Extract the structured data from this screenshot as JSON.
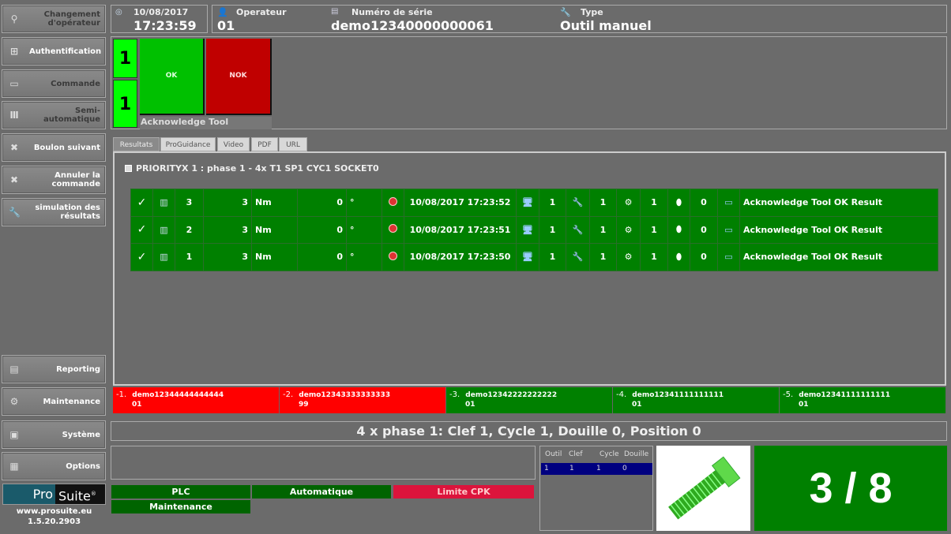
{
  "sidebar": {
    "top": [
      {
        "label": "Changement d'opérateur",
        "icon": "user-change-icon",
        "dim": true
      },
      {
        "label": "Authentification",
        "icon": "login-icon",
        "dim": false
      },
      {
        "label": "Commande",
        "icon": "order-icon",
        "dim": true
      },
      {
        "label": "Semi-automatique",
        "icon": "semi-auto-icon",
        "dim": true
      },
      {
        "label": "Boulon suivant",
        "icon": "next-bolt-icon",
        "dim": false
      },
      {
        "label": "Annuler la commande",
        "icon": "cancel-order-icon",
        "dim": false
      },
      {
        "label": "simulation des résultats",
        "icon": "wrench-icon",
        "dim": false
      }
    ],
    "bottom": [
      {
        "label": "Reporting",
        "icon": "report-icon"
      },
      {
        "label": "Maintenance",
        "icon": "maintenance-icon"
      },
      {
        "label": "Système",
        "icon": "system-icon"
      },
      {
        "label": "Options",
        "icon": "options-icon"
      }
    ],
    "logo": "ProSuite",
    "website": "www.prosuite.eu",
    "version": "1.5.20.2903"
  },
  "header": {
    "date": "10/08/2017",
    "time": "17:23:59",
    "operator_label": "Operateur",
    "operator": "01",
    "serial_label": "Numéro de série",
    "serial": "demo12340000000061",
    "type_label": "Type",
    "type": "Outil manuel"
  },
  "ack": {
    "count_ok": "1",
    "count_nok": "1",
    "ok": "OK",
    "nok": "NOK",
    "title": "Acknowledge Tool"
  },
  "tabs": [
    {
      "label": "Resultats",
      "active": true
    },
    {
      "label": "ProGuidance"
    },
    {
      "label": "Video"
    },
    {
      "label": "PDF"
    },
    {
      "label": "URL"
    }
  ],
  "results": {
    "title": "PRIORITYX 1 :  phase 1 - 4x T1 SP1 CYC1 SOCKET0",
    "rows": [
      {
        "num": "3",
        "torque": "3",
        "tunit": "Nm",
        "angle": "0",
        "aunit": "°",
        "date": "10/08/2017 17:23:52",
        "v1": "1",
        "v2": "1",
        "v3": "1",
        "v4": "0",
        "msg": "Acknowledge Tool OK Result"
      },
      {
        "num": "2",
        "torque": "3",
        "tunit": "Nm",
        "angle": "0",
        "aunit": "°",
        "date": "10/08/2017 17:23:51",
        "v1": "1",
        "v2": "1",
        "v3": "1",
        "v4": "0",
        "msg": "Acknowledge Tool OK Result"
      },
      {
        "num": "1",
        "torque": "3",
        "tunit": "Nm",
        "angle": "0",
        "aunit": "°",
        "date": "10/08/2017 17:23:50",
        "v1": "1",
        "v2": "1",
        "v3": "1",
        "v4": "0",
        "msg": "Acknowledge Tool OK Result"
      }
    ]
  },
  "recent": [
    {
      "idx": "-1.",
      "serial": "demo12344444444444",
      "code": "01",
      "color": "#ff0000"
    },
    {
      "idx": "-2.",
      "serial": "demo12343333333333",
      "code": "99",
      "color": "#ff0000"
    },
    {
      "idx": "-3.",
      "serial": "demo12342222222222",
      "code": "01",
      "color": "#008000"
    },
    {
      "idx": "-4.",
      "serial": "demo12341111111111",
      "code": "01",
      "color": "#008000"
    },
    {
      "idx": "-5.",
      "serial": "demo12341111111111",
      "code": "01",
      "color": "#008000"
    }
  ],
  "status_line": "4 x  phase 1: Clef  1, Cycle 1, Douille 0, Position 0",
  "badges": {
    "plc": "PLC",
    "auto": "Automatique",
    "cpk": "Limite CPK",
    "maint": "Maintenance"
  },
  "tool_table": {
    "headers": [
      "Outil",
      "Clef",
      "Cycle",
      "Douille"
    ],
    "row": [
      "1",
      "1",
      "1",
      "0"
    ]
  },
  "counter": "3 / 8",
  "colors": {
    "ok": "#00c000",
    "nok": "#c00000",
    "counter_green": "#00ff00",
    "row_green": "#008000",
    "cpk": "#dc143c",
    "selected_row": "#000080"
  }
}
